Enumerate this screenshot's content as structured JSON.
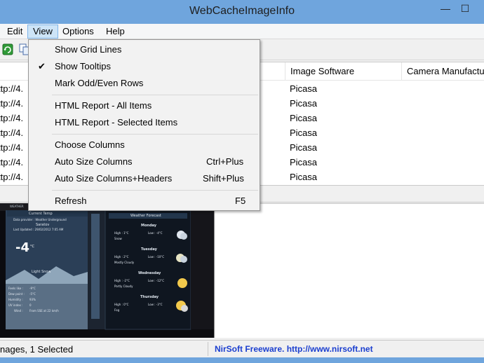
{
  "window": {
    "title": "WebCacheImageInfo",
    "minimize_glyph": "—",
    "maximize_glyph": "☐"
  },
  "menubar": {
    "items": [
      {
        "label": "Edit"
      },
      {
        "label": "View"
      },
      {
        "label": "Options"
      },
      {
        "label": "Help"
      }
    ],
    "active": "View"
  },
  "toolbar": {
    "icons": [
      "refresh-icon",
      "copy-icon"
    ]
  },
  "listview": {
    "columns": [
      {
        "label": ""
      },
      {
        "label": "Image Software"
      },
      {
        "label": "Camera Manufactu"
      }
    ],
    "rows": [
      {
        "url": "ttp://4.",
        "software": "Picasa"
      },
      {
        "url": "ttp://4.",
        "software": "Picasa"
      },
      {
        "url": "ttp://4.",
        "software": "Picasa"
      },
      {
        "url": "ttp://4.",
        "software": "Picasa"
      },
      {
        "url": "ttp://4.",
        "software": "Picasa"
      },
      {
        "url": "ttp://4.",
        "software": "Picasa"
      },
      {
        "url": "ttp://4.",
        "software": "Picasa"
      }
    ]
  },
  "view_menu": {
    "items": [
      {
        "label": "Show Grid Lines",
        "checked": false,
        "shortcut": ""
      },
      {
        "label": "Show Tooltips",
        "checked": true,
        "shortcut": "",
        "check_glyph": "✔"
      },
      {
        "label": "Mark Odd/Even Rows",
        "checked": false,
        "shortcut": ""
      },
      {
        "label": "HTML Report - All Items",
        "checked": false,
        "shortcut": ""
      },
      {
        "label": "HTML Report - Selected Items",
        "checked": false,
        "shortcut": ""
      },
      {
        "label": "Choose Columns",
        "checked": false,
        "shortcut": ""
      },
      {
        "label": "Auto Size Columns",
        "checked": false,
        "shortcut": "Ctrl+Plus"
      },
      {
        "label": "Auto Size Columns+Headers",
        "checked": false,
        "shortcut": "Shift+Plus"
      },
      {
        "label": "Refresh",
        "checked": false,
        "shortcut": "F5"
      }
    ]
  },
  "preview": {
    "weather": {
      "badge": "WEATHER",
      "current_title": "Current Temp",
      "provider": "Data provider : Weather Underground",
      "city": "Saratov",
      "last_updated": "Last Updated : 29/02/2012 7:05 AM",
      "temperature": "-4",
      "degree": "°C",
      "condition": "Light Snow",
      "details": [
        {
          "label": "Feels like :",
          "value": "-9°C"
        },
        {
          "label": "Dew point :",
          "value": "-5°C"
        },
        {
          "label": "Humidity :",
          "value": "93%"
        },
        {
          "label": "UV index :",
          "value": "0"
        },
        {
          "label": "Wind :",
          "value": "From SSE at 22 km/h"
        }
      ],
      "forecast_title": "Weather Forecast",
      "forecast": [
        {
          "day": "Monday",
          "high": "High : 1°C",
          "low": "Low : -4°C",
          "condition": "Snow"
        },
        {
          "day": "Tuesday",
          "high": "High : 2°C",
          "low": "Low : -10°C",
          "condition": "Mostly Cloudy"
        },
        {
          "day": "Wednesday",
          "high": "High : -2°C",
          "low": "Low : -12°C",
          "condition": "Partly Cloudy"
        },
        {
          "day": "Thursday",
          "high": "High : 0°C",
          "low": "Low : -3°C",
          "condition": "Fog"
        }
      ]
    }
  },
  "statusbar": {
    "left": "nages, 1 Selected",
    "right": "NirSoft Freeware.  http://www.nirsoft.net"
  },
  "colors": {
    "title_bar": "#6fa5dd",
    "desktop": "#e5c33a",
    "menu_highlight": "#cde4f7",
    "link": "#1a3ecf"
  }
}
